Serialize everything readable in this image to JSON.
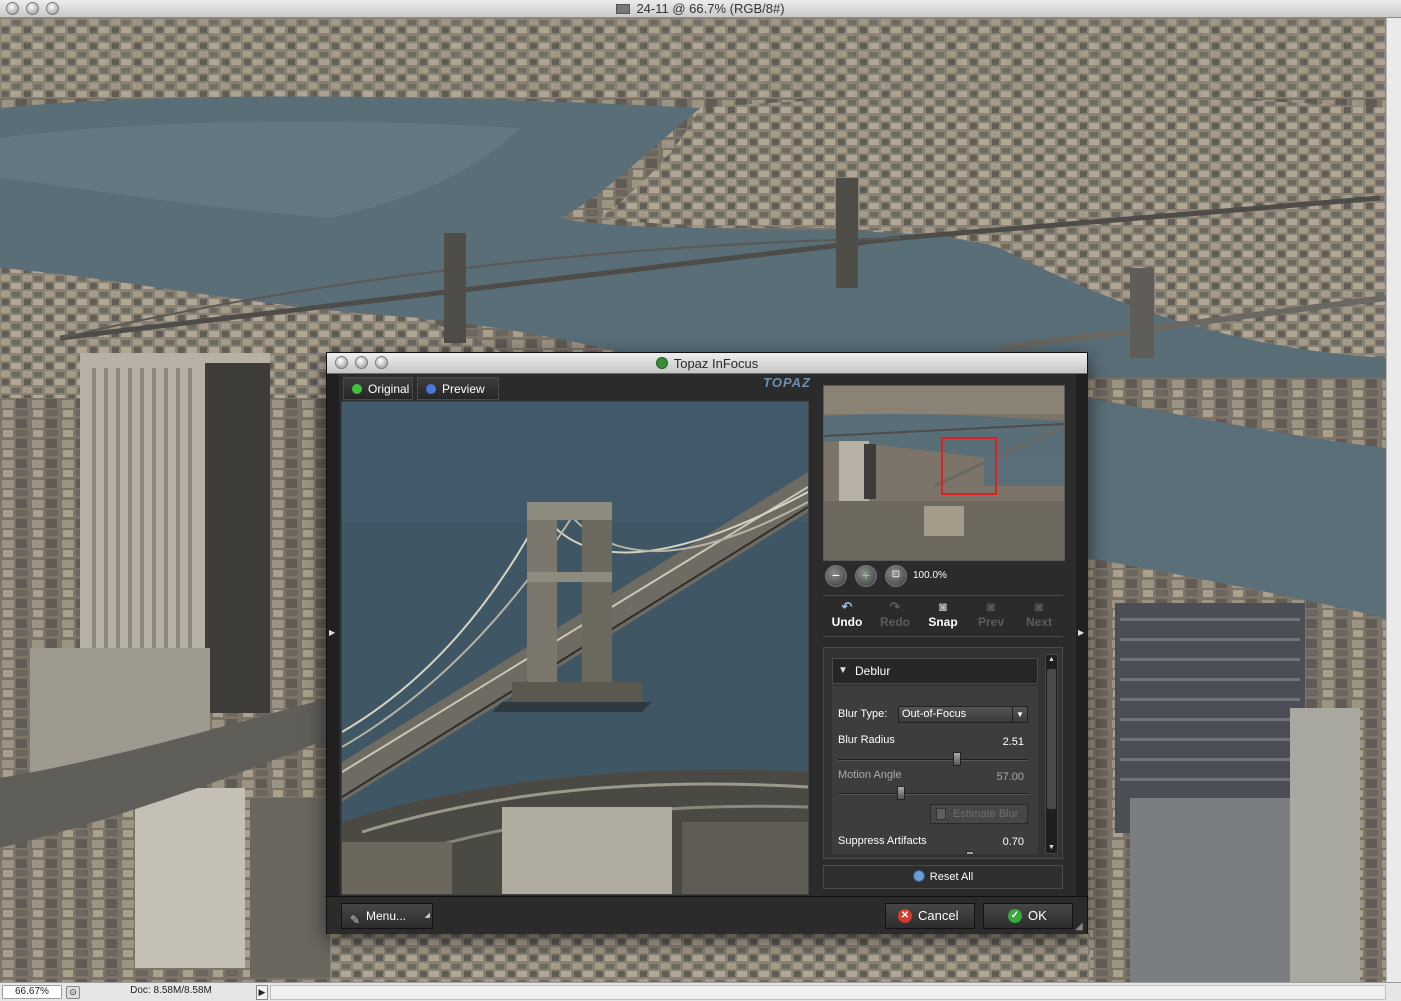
{
  "window": {
    "title": "24-11 @ 66.7% (RGB/8#)"
  },
  "statusbar": {
    "zoom": "66.67%",
    "doc_info": "Doc: 8.58M/8.58M"
  },
  "dialog": {
    "title": "Topaz InFocus",
    "brand": "TOPAZ",
    "tabs": [
      {
        "label": "Original",
        "dot_color": "#3fc23f"
      },
      {
        "label": "Preview",
        "dot_color": "#4a78d8"
      }
    ],
    "zoom_level": "100.0%",
    "history": [
      {
        "label": "Undo",
        "icon": "undo-icon",
        "enabled": true
      },
      {
        "label": "Redo",
        "icon": "redo-icon",
        "enabled": false
      },
      {
        "label": "Snap",
        "icon": "camera-icon",
        "enabled": true
      },
      {
        "label": "Prev",
        "icon": "prev-icon",
        "enabled": false
      },
      {
        "label": "Next",
        "icon": "next-icon",
        "enabled": false
      }
    ],
    "deblur": {
      "header": "Deblur",
      "blur_type_label": "Blur Type:",
      "blur_type_value": "Out-of-Focus",
      "blur_radius_label": "Blur Radius",
      "blur_radius_value": "2.51",
      "motion_angle_label": "Motion Angle",
      "motion_angle_value": "57.00",
      "estimate_label": "Estimate Blur",
      "suppress_label": "Suppress Artifacts",
      "suppress_value": "0.70"
    },
    "reset_all": "Reset All",
    "menu": "Menu...",
    "cancel": "Cancel",
    "ok": "OK"
  },
  "colors": {
    "accent_red": "#d43b2c",
    "accent_green": "#39a83d",
    "dialog_bg": "#2b2b2b"
  }
}
